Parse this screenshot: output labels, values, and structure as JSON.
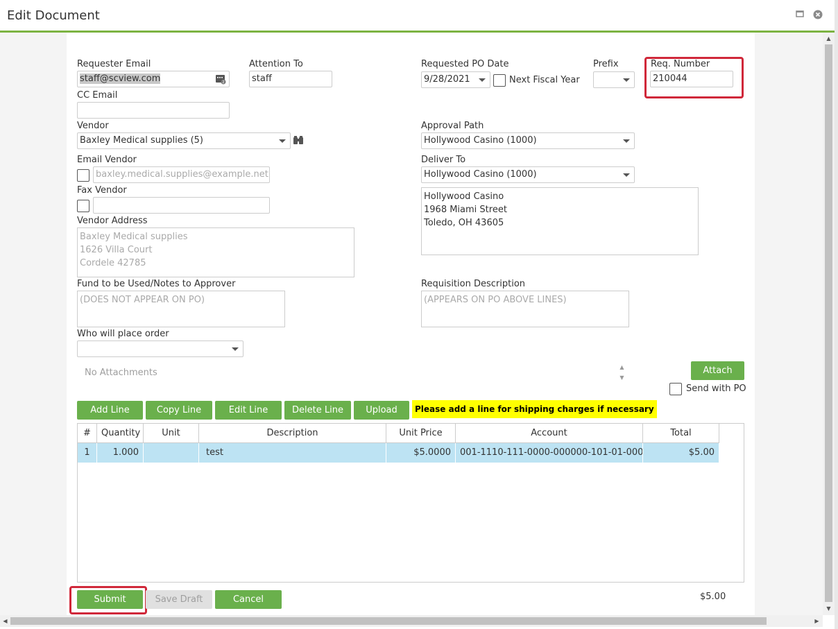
{
  "window": {
    "title": "Edit Document",
    "maximize_icon": "window-maximize-icon",
    "close_icon": "close-icon"
  },
  "form": {
    "requester_email": {
      "label": "Requester Email",
      "value": "staff@scview.com"
    },
    "attention_to": {
      "label": "Attention To",
      "value": "staff"
    },
    "requested_po_date": {
      "label": "Requested PO Date",
      "value": "9/28/2021"
    },
    "next_fiscal_year": {
      "label": "Next Fiscal Year",
      "checked": false
    },
    "prefix": {
      "label": "Prefix",
      "value": ""
    },
    "req_number": {
      "label": "Req. Number",
      "value": "210044"
    },
    "cc_email": {
      "label": "CC Email",
      "value": ""
    },
    "vendor": {
      "label": "Vendor",
      "value": "Baxley Medical supplies (5)"
    },
    "approval_path": {
      "label": "Approval Path",
      "value": "Hollywood Casino (1000)"
    },
    "email_vendor": {
      "label": "Email Vendor",
      "checked": false,
      "placeholder": "baxley.medical.supplies@example.net"
    },
    "deliver_to": {
      "label": "Deliver To",
      "value": "Hollywood Casino (1000)",
      "address": [
        "Hollywood Casino",
        "1968 Miami Street",
        "Toledo, OH  43605"
      ]
    },
    "fax_vendor": {
      "label": "Fax Vendor",
      "checked": false,
      "value": ""
    },
    "vendor_address": {
      "label": "Vendor Address",
      "lines": [
        "Baxley Medical supplies",
        "1626 Villa Court",
        "Cordele  42785"
      ]
    },
    "fund_notes": {
      "label": "Fund to be Used/Notes to Approver",
      "placeholder": "(DOES NOT APPEAR ON PO)"
    },
    "requisition_description": {
      "label": "Requisition Description",
      "placeholder": "(APPEARS ON PO ABOVE LINES)"
    },
    "who_will_place_order": {
      "label": "Who will place order",
      "value": ""
    }
  },
  "attachments": {
    "empty_text": "No Attachments",
    "attach_button": "Attach",
    "send_with_po": {
      "label": "Send with PO",
      "checked": false
    }
  },
  "line_toolbar": {
    "add": "Add Line",
    "copy": "Copy Line",
    "edit": "Edit Line",
    "delete": "Delete Line",
    "upload": "Upload",
    "notice": "Please add a line for shipping charges if necessary"
  },
  "lines_table": {
    "columns": [
      "#",
      "Quantity",
      "Unit",
      "Description",
      "Unit Price",
      "Account",
      "Total"
    ],
    "rows": [
      [
        "1",
        "1.000",
        "",
        "test",
        "$5.0000",
        "001-1110-111-0000-000000-101-01-000",
        "$5.00"
      ]
    ]
  },
  "footer": {
    "submit": "Submit",
    "save_draft": "Save Draft",
    "cancel": "Cancel",
    "grand_total": "$5.00"
  },
  "colors": {
    "accent_green": "#6ab04c",
    "highlight_red": "#d0283a",
    "selected_row": "#bde3f3",
    "notice_yellow": "#ffff00"
  }
}
